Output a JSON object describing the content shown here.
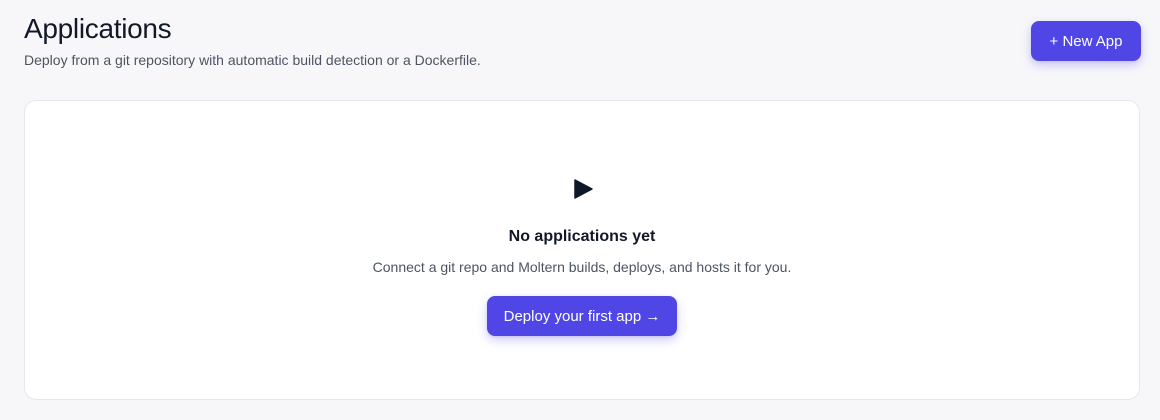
{
  "header": {
    "title": "Applications",
    "subtitle": "Deploy from a git repository with automatic build detection or a Dockerfile."
  },
  "toolbar": {
    "new_app_label": "+ New App"
  },
  "empty_state": {
    "icon": "play-icon",
    "title": "No applications yet",
    "description": "Connect a git repo and Moltern builds, deploys, and hosts it for you.",
    "cta_label": "Deploy your first app →"
  },
  "colors": {
    "accent": "#4f46e5",
    "background": "#f7f7fa",
    "card": "#ffffff",
    "text": "#111827",
    "muted": "#4b5563"
  }
}
